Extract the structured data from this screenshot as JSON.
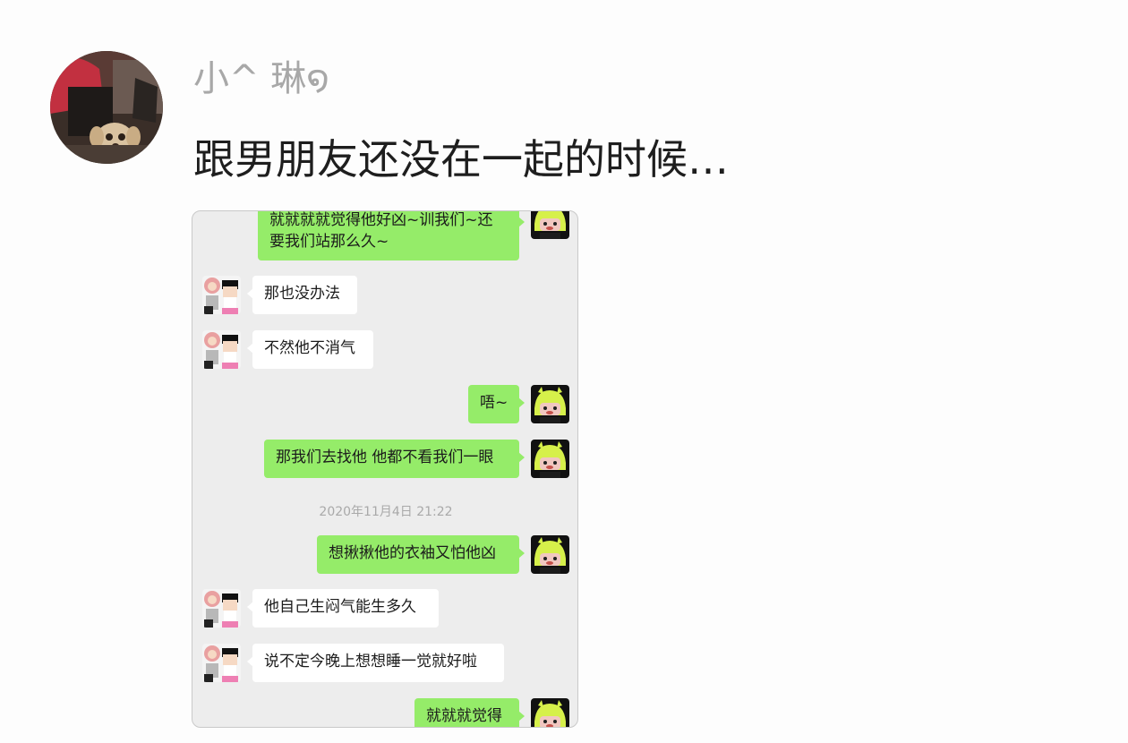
{
  "post": {
    "username": "小^ 琳໑",
    "text": "跟男朋友还没在一起的时候…"
  },
  "chat": {
    "timestamp": "2020年11月4日 21:22",
    "messages": [
      {
        "side": "right",
        "text_line1": "就就就就觉得他好凶~训我们~还",
        "text_line2": "要我们站那么久~"
      },
      {
        "side": "left",
        "text": "那也没办法"
      },
      {
        "side": "left",
        "text": "不然他不消气"
      },
      {
        "side": "right",
        "text": "唔~"
      },
      {
        "side": "right",
        "text": "那我们去找他 他都不看我们一眼"
      },
      {
        "side": "right",
        "text": "想揪揪他的衣袖又怕他凶"
      },
      {
        "side": "left",
        "text": "他自己生闷气能生多久"
      },
      {
        "side": "left",
        "text": "说不定今晚上想想睡一觉就好啦"
      },
      {
        "side": "right",
        "text": "就就就觉得"
      }
    ]
  },
  "colors": {
    "sent_bubble": "#95ec69",
    "received_bubble": "#ffffff",
    "chat_background": "#ededed"
  },
  "icons": {
    "post_avatar": "avatar-photo-icon",
    "self_avatar": "green-haired-girl-avatar-icon",
    "contact_avatar": "couple-cartoon-avatar-icon"
  }
}
